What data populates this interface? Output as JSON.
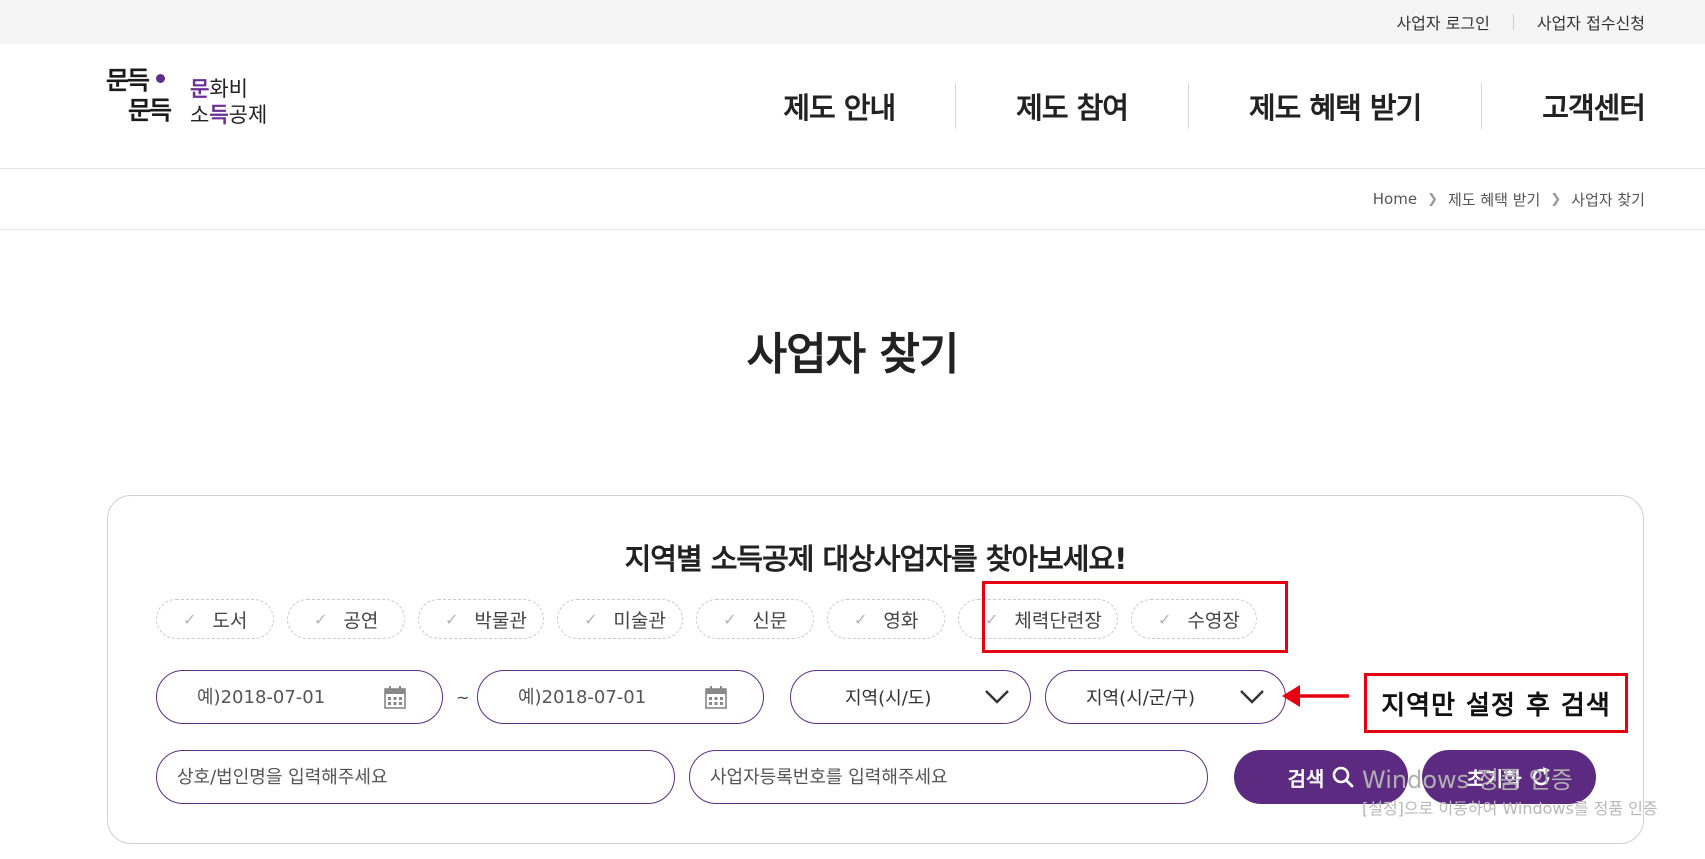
{
  "topbar": {
    "login": "사업자 로그인",
    "signup": "사업자 접수신청"
  },
  "logo": {
    "mark_line1": "문득",
    "mark_line2": "문득",
    "text_line1_accent": "문",
    "text_line1_rest": "화비",
    "text_line2_pre": "소",
    "text_line2_accent": "득",
    "text_line2_rest": "공제"
  },
  "nav": {
    "items": [
      {
        "label": "제도 안내"
      },
      {
        "label": "제도 참여"
      },
      {
        "label": "제도 혜택 받기"
      },
      {
        "label": "고객센터"
      }
    ]
  },
  "breadcrumb": {
    "home": "Home",
    "level1": "제도 혜택 받기",
    "level2": "사업자 찾기"
  },
  "page": {
    "title": "사업자 찾기"
  },
  "search": {
    "heading": "지역별 소득공제 대상사업자를 찾아보세요!",
    "categories": [
      {
        "label": "도서"
      },
      {
        "label": "공연"
      },
      {
        "label": "박물관"
      },
      {
        "label": "미술관"
      },
      {
        "label": "신문"
      },
      {
        "label": "영화"
      },
      {
        "label": "체력단련장"
      },
      {
        "label": "수영장"
      }
    ],
    "date_from_placeholder": "예)2018-07-01",
    "date_to_placeholder": "예)2018-07-01",
    "date_separator": "~",
    "region_sido": "지역(시/도)",
    "region_sigungu": "지역(시/군/구)",
    "name_placeholder": "상호/법인명을 입력해주세요",
    "bizno_placeholder": "사업자등록번호를 입력해주세요",
    "search_button": "검색",
    "reset_button": "초기화"
  },
  "annotation": {
    "label": "지역만 설정 후 검색",
    "color": "#e60012"
  },
  "watermark": {
    "line1": "Windows 정품 인증",
    "line2": "[설정]으로 이동하여 Windows를 정품 인증"
  },
  "colors": {
    "accent": "#5d2f86",
    "button": "#5d2a82"
  }
}
